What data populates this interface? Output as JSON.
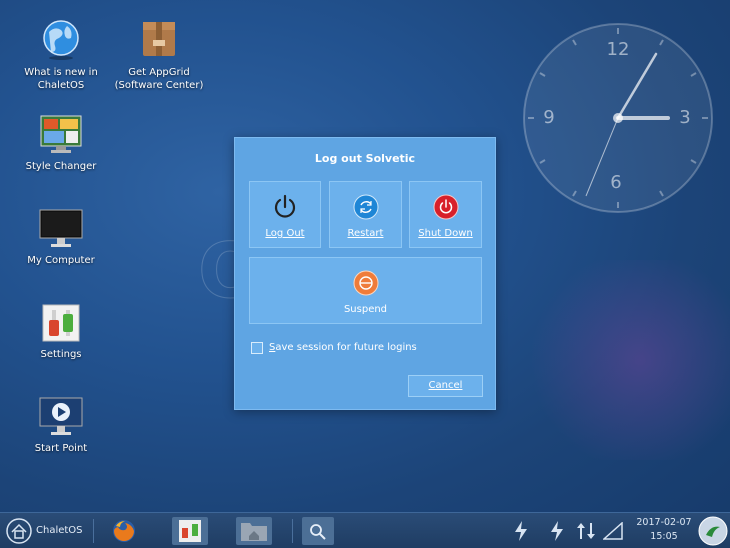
{
  "desktop": {
    "icons": [
      {
        "label": "What is new in\nChaletOS"
      },
      {
        "label": "Get AppGrid\n(Software Center)"
      },
      {
        "label": "Style Changer"
      },
      {
        "label": "My Computer"
      },
      {
        "label": "Settings"
      },
      {
        "label": "Start Point"
      }
    ],
    "clock": {
      "numerals": [
        "12",
        "3",
        "6",
        "9"
      ],
      "time": "15:05"
    }
  },
  "dialog": {
    "title": "Log out Solvetic",
    "buttons": {
      "logout": "Log Out",
      "restart": "Restart",
      "shutdown": "Shut Down",
      "suspend": "Suspend"
    },
    "save_session": {
      "label_first": "S",
      "label_rest": "ave session for future logins",
      "checked": false
    },
    "cancel": "Cancel"
  },
  "taskbar": {
    "start_label": "ChaletOS",
    "date": "2017-02-07",
    "time": "15:05"
  },
  "colors": {
    "dialog_bg": "#5fa5e3",
    "restart_blue": "#1e86d6",
    "shutdown_red": "#d8202a",
    "suspend_orange": "#ef7c3a"
  }
}
